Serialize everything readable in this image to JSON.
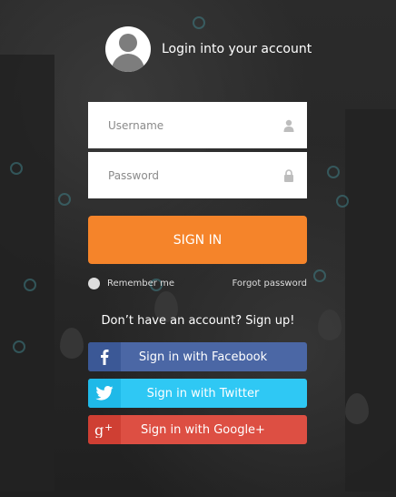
{
  "header": {
    "title": "Login into your account"
  },
  "form": {
    "username_placeholder": "Username",
    "password_placeholder": "Password",
    "signin_label": "SIGN IN",
    "remember_label": "Remember me",
    "forgot_label": "Forgot password"
  },
  "signup": {
    "text": "Don’t have an account? Sign up!"
  },
  "social": {
    "facebook_label": "Sign in with Facebook",
    "twitter_label": "Sign in with Twitter",
    "google_label": "Sign in with Google+",
    "colors": {
      "facebook": "#4b67a5",
      "twitter": "#2fc8f4",
      "google": "#dd4f43",
      "signin": "#f5842a"
    }
  },
  "icons": {
    "avatar": "user-avatar-icon",
    "username": "user-icon",
    "password": "lock-icon",
    "facebook": "facebook-icon",
    "twitter": "twitter-icon",
    "google": "google-plus-icon"
  }
}
